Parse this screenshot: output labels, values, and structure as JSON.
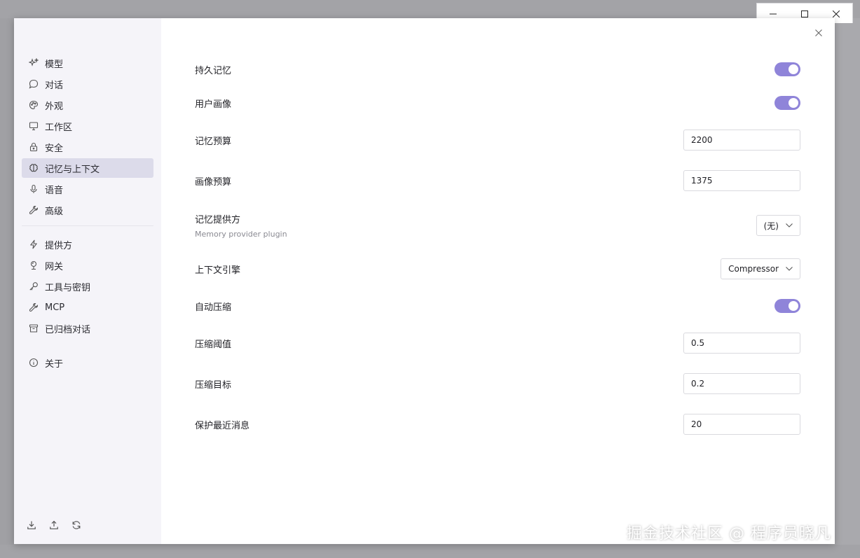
{
  "colors": {
    "accent": "#8f84d9",
    "sidebar_bg": "#f5f4f9",
    "active_item_bg": "#dcdbea"
  },
  "sidebar": {
    "items_top": [
      {
        "label": "模型",
        "icon": "sparkles-icon"
      },
      {
        "label": "对话",
        "icon": "chat-bubble-icon"
      },
      {
        "label": "外观",
        "icon": "palette-icon"
      },
      {
        "label": "工作区",
        "icon": "monitor-icon"
      },
      {
        "label": "安全",
        "icon": "lock-icon"
      },
      {
        "label": "记忆与上下文",
        "icon": "brain-icon",
        "active": true
      },
      {
        "label": "语音",
        "icon": "microphone-icon"
      },
      {
        "label": "高级",
        "icon": "wrench-icon"
      }
    ],
    "items_mid": [
      {
        "label": "提供方",
        "icon": "lightning-icon"
      },
      {
        "label": "网关",
        "icon": "gateway-icon"
      },
      {
        "label": "工具与密钥",
        "icon": "key-icon"
      },
      {
        "label": "MCP",
        "icon": "tools-icon"
      },
      {
        "label": "已归档对话",
        "icon": "archive-icon"
      }
    ],
    "items_bottom": [
      {
        "label": "关于",
        "icon": "info-icon"
      }
    ],
    "footer": [
      "download-icon",
      "upload-icon",
      "refresh-icon"
    ]
  },
  "settings": {
    "persistent_memory": {
      "label": "持久记忆",
      "enabled": true
    },
    "user_profile": {
      "label": "用户画像",
      "enabled": true
    },
    "memory_budget": {
      "label": "记忆预算",
      "value": "2200"
    },
    "profile_budget": {
      "label": "画像预算",
      "value": "1375"
    },
    "memory_provider": {
      "label": "记忆提供方",
      "description": "Memory provider plugin",
      "selected": "(无)"
    },
    "context_engine": {
      "label": "上下文引擎",
      "selected": "Compressor"
    },
    "auto_compress": {
      "label": "自动压缩",
      "enabled": true
    },
    "compress_threshold": {
      "label": "压缩阈值",
      "value": "0.5"
    },
    "compress_target": {
      "label": "压缩目标",
      "value": "0.2"
    },
    "protect_recent": {
      "label": "保护最近消息",
      "value": "20"
    }
  },
  "watermark": "掘金技术社区 @ 程序员晓凡"
}
